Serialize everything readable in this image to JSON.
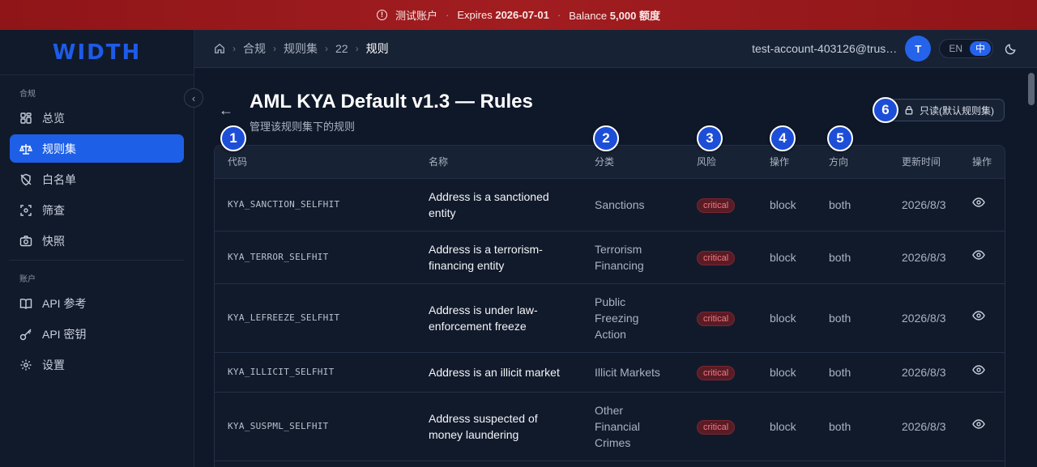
{
  "banner": {
    "account": "测试账户",
    "expires_label": "Expires",
    "expires_date": "2026-07-01",
    "balance_label": "Balance",
    "balance_value": "5,000",
    "balance_unit": "额度"
  },
  "sidebar": {
    "logo": "WIDTH",
    "section1": "合规",
    "section2": "账户",
    "items": [
      {
        "label": "总览",
        "icon": "grid-icon"
      },
      {
        "label": "规则集",
        "icon": "scale-icon"
      },
      {
        "label": "白名单",
        "icon": "shield-off-icon"
      },
      {
        "label": "筛查",
        "icon": "scan-icon"
      },
      {
        "label": "快照",
        "icon": "camera-icon"
      },
      {
        "label": "API 参考",
        "icon": "book-icon"
      },
      {
        "label": "API 密钥",
        "icon": "key-icon"
      },
      {
        "label": "设置",
        "icon": "gear-icon"
      }
    ]
  },
  "header": {
    "crumbs": [
      "合规",
      "规则集",
      "22",
      "规则"
    ],
    "email": "test-account-403126@trus…",
    "avatar": "T",
    "lang_en": "EN",
    "lang_zh": "中"
  },
  "page": {
    "title": "AML KYA Default v1.3 — Rules",
    "subtitle": "管理该规则集下的规则",
    "readonly": "只读(默认规则集)"
  },
  "table": {
    "columns": [
      "代码",
      "名称",
      "分类",
      "风险",
      "操作",
      "方向",
      "更新时间",
      "操作"
    ],
    "rows": [
      {
        "code": "KYA_SANCTION_SELFHIT",
        "name": "Address is a sanctioned entity",
        "category": "Sanctions",
        "risk": "critical",
        "action": "block",
        "direction": "both",
        "updated": "2026/8/3"
      },
      {
        "code": "KYA_TERROR_SELFHIT",
        "name": "Address is a terrorism-financing entity",
        "category": "Terrorism Financing",
        "risk": "critical",
        "action": "block",
        "direction": "both",
        "updated": "2026/8/3"
      },
      {
        "code": "KYA_LEFREEZE_SELFHIT",
        "name": "Address is under law-enforcement freeze",
        "category": "Public Freezing Action",
        "risk": "critical",
        "action": "block",
        "direction": "both",
        "updated": "2026/8/3"
      },
      {
        "code": "KYA_ILLICIT_SELFHIT",
        "name": "Address is an illicit market",
        "category": "Illicit Markets",
        "risk": "critical",
        "action": "block",
        "direction": "both",
        "updated": "2026/8/3"
      },
      {
        "code": "KYA_SUSPML_SELFHIT",
        "name": "Address suspected of money laundering",
        "category": "Other Financial Crimes",
        "risk": "critical",
        "action": "block",
        "direction": "both",
        "updated": "2026/8/3"
      }
    ]
  },
  "markers": [
    "1",
    "2",
    "3",
    "4",
    "5",
    "6"
  ]
}
